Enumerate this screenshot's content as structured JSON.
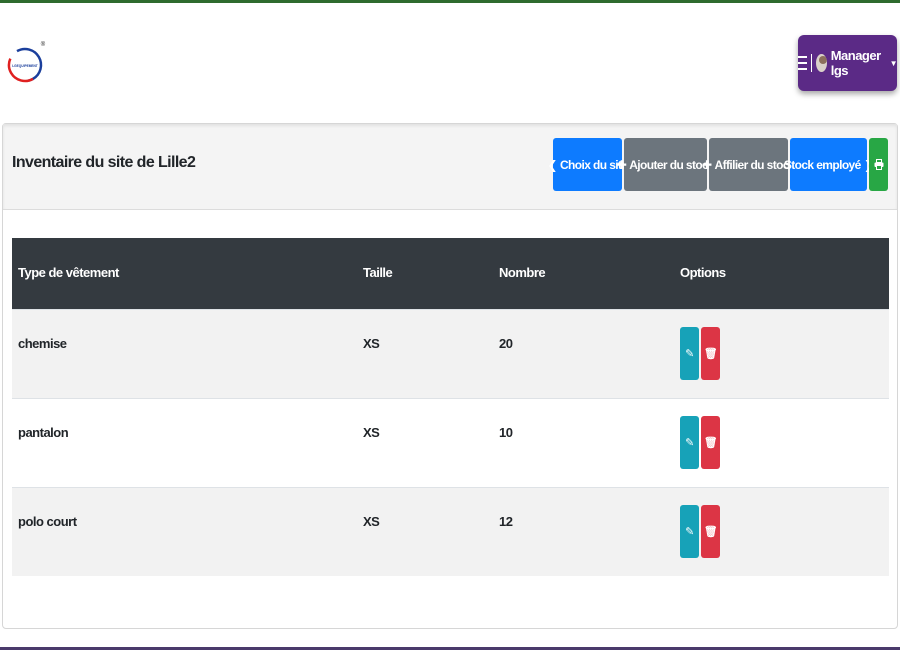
{
  "header": {
    "user_name": "Manager lgs",
    "logo_text": "LGEQUIPEMENT",
    "logo_registered": "®"
  },
  "card": {
    "title": "Inventaire du site de Lille2",
    "buttons": {
      "choose_site": "Choix du site",
      "add_stock": "Ajouter du stock",
      "assign_stock": "Affilier du stock",
      "employee_stock": "Stock employé",
      "print_icon": "print-icon"
    }
  },
  "table": {
    "headers": [
      "Type de vêtement",
      "Taille",
      "Nombre",
      "Options"
    ],
    "rows": [
      {
        "type": "chemise",
        "size": "XS",
        "count": "20"
      },
      {
        "type": "pantalon",
        "size": "XS",
        "count": "10"
      },
      {
        "type": "polo court",
        "size": "XS",
        "count": "12"
      }
    ]
  },
  "colors": {
    "user_menu": "#5b2a86",
    "primary": "#0d7bff",
    "secondary": "#6c757d",
    "success": "#28a745",
    "info": "#17a2b8",
    "danger": "#dc3545",
    "table_head": "#343a40"
  }
}
